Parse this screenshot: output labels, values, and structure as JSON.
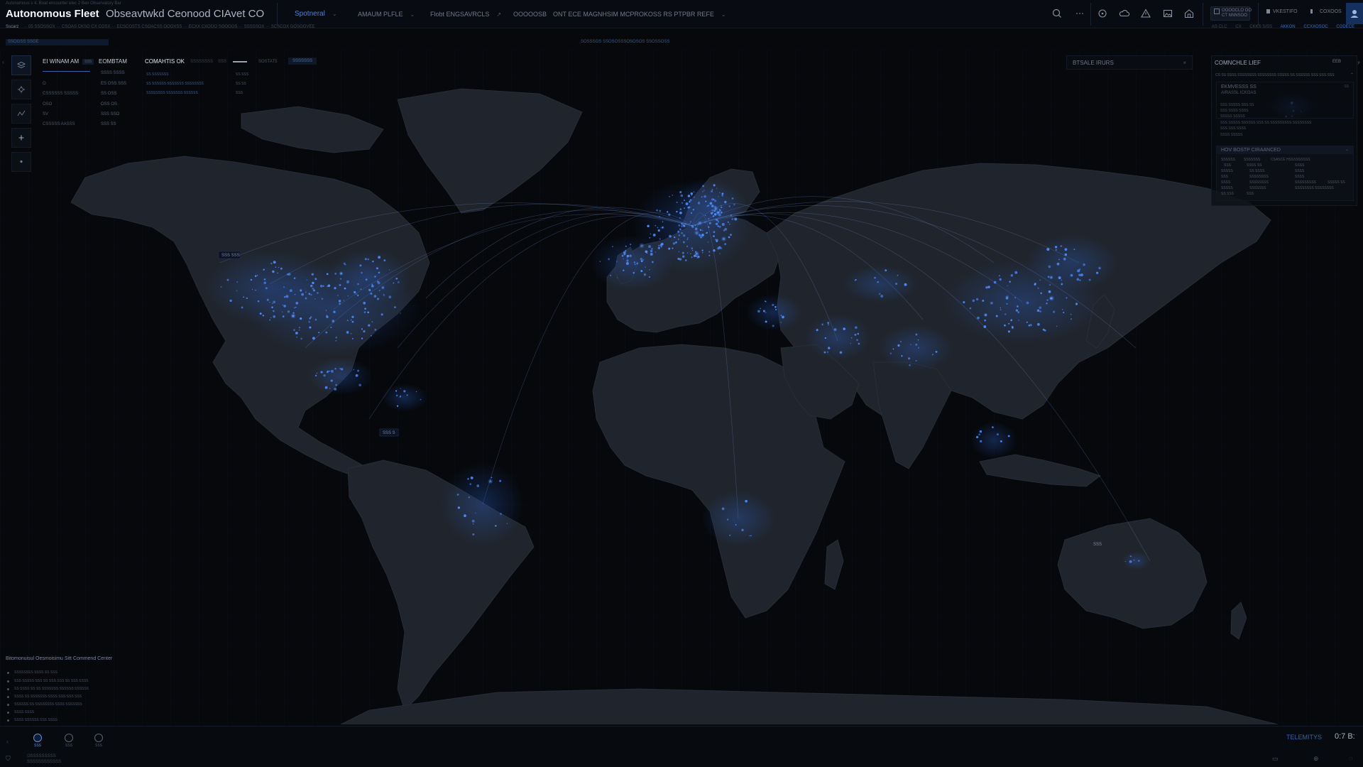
{
  "header": {
    "crumb": "Autonomous v 4. Boat encounter elec 2 Ben Observatory Bar",
    "title": "Autonomous Fleet",
    "subtitle": "Obseavtwkd Ceonood CIAvet CO",
    "nav": [
      {
        "label": "Spotneral",
        "chevron": "⌄"
      },
      {
        "label": "AMAUM PLFLE",
        "chevron": "⌄"
      },
      {
        "label": "Flobt ENGSAVRCLS",
        "chevron": "↗"
      },
      {
        "label": "OOOOOSB",
        "chevron": ""
      },
      {
        "label": "ONT ECE MAGNHSIM MCPROKOSS RS PTPBR REFE",
        "chevron": "⌄"
      }
    ],
    "chip1": "OOOOCLO OO\nCT NNNSOO",
    "label1": "VKESTIFO",
    "label2": "COXOOS"
  },
  "subbar": {
    "left_strong": "Sscarz",
    "left": "·· 05 SSOSSOX ··· CSOAS CKSO CX COSX ··· ECSCOSTS CSOACSS OOOXSS ··· ECXX CXOOO SOOOOS ··· SSSSSOX ··· SCSCOX GOSGGVEE",
    "right": [
      "AS CLC",
      "CX",
      "CKKS SISS",
      "AKKON",
      "CCXXOSOC",
      "CODECE"
    ]
  },
  "filters": {
    "left": "SSOGSS SSGE",
    "center": "SOSSSOS SSOSOSSSOSOSOS SSOSSOSS"
  },
  "stats_panel": {
    "tabs": [
      "EI WINAM AM",
      "EOMBTAM",
      "COMAHTIS OK",
      "SSSSSSSS",
      "SSS",
      "SOSTAT5",
      "SSSSSSS"
    ],
    "tab_badge": "SSS",
    "rows": [
      {
        "k": "",
        "v": "SSSS SSSS"
      },
      {
        "k": "O",
        "v": "ES OSS SSS"
      },
      {
        "k": "CSSSSSS SSSSS",
        "v": "SS OSS"
      },
      {
        "k": "OSO",
        "v": "OSS OS"
      },
      {
        "k": "SV",
        "v": "SSS SSO"
      },
      {
        "k": "CSSSSS AASSS",
        "v": "SSS SS"
      }
    ],
    "mini": [
      {
        "k": "SS SSSSSSS",
        "v": "SS SSS"
      },
      {
        "k": "SS SSSSSS SSSSSSS SSSSSSSS",
        "v": "SS SS"
      },
      {
        "k": "SSSSSSSS SSSSSSS SSSSSS",
        "v": "SSS"
      }
    ]
  },
  "broadcast": {
    "label": "BTSALE IRURS",
    "close": "×"
  },
  "right_panel": {
    "title": "COMNCHLE LIEF",
    "badge": "EEB",
    "arrow": "›",
    "sub": "CS SS SSSS SSSSSSSS SSSSSSSS SSSSS SS SSSSSS SSS SSS SSS",
    "s1_title": "EKMVESSS SS",
    "s1_sub": "AIRASSL ICKOAS",
    "s1_badge": "SS",
    "lines": [
      "SSS SSSSS SSS SS",
      "SSS SSSS SSSS",
      "SSSSS SSSSS",
      "SSS SSSSS SSSSSS SSS SS SSSSSSSSS SSSSSSSS",
      "SSS SSS SSSS",
      "SSSS SSSSS"
    ],
    "s2_title": "HOV BOSTP CIRAANCED",
    "s2_rows": [
      [
        "SSSSSS",
        "SSSSSSS",
        "CSASCE HSSSSSSSSS",
        ""
      ],
      [
        "SSS",
        "SSSS SS",
        "SSSS",
        ""
      ],
      [
        "SSSSS",
        "SS SSSS",
        "SSSS",
        ""
      ],
      [
        "SSS",
        "SSSSSSSS",
        "SSSS",
        ""
      ],
      [
        "SSSS",
        "SSSSSSSS",
        "SSSSSSSSS",
        "SSSSS SS"
      ],
      [
        "SSSSS",
        "SSSSSSS",
        "SSSSSSSS SSSSSSSS",
        ""
      ],
      [
        "SS SSS",
        "SSS",
        "",
        ""
      ]
    ]
  },
  "map_labels": {
    "na": "SSS SSS",
    "sa": "SSS S",
    "au": "SSS"
  },
  "legend": {
    "title": "Bitomonuisul Oesmoisimu Sitt Commend Center",
    "items": [
      "SSSSSSSS SSSS SS SSS",
      "SSS SSSSS SSS SS SSS SSS SS SSS SSSS",
      "SS SSSS SS SS SSSSSSS SSSSSS SSSSSS",
      "SSSS SS SSSSSSS SSSS SSS SSS SSS",
      "SSSSSS SS SSSSSSSS SSSS SSSSSSS",
      "SSSS SSSS",
      "SSSS SSSSSS SSS SSSS"
    ]
  },
  "dock": {
    "buttons": [
      "SSS",
      "SSS",
      "SSS"
    ],
    "status_line1": "OSSSSSSSSS",
    "status_line2": "SSSSSSSSSSSS",
    "telemetry_label": "TELEMITYS",
    "telemetry_value": "0:7 B:"
  },
  "icons": [
    "search-icon",
    "more-icon",
    "target-icon",
    "cloud-icon",
    "alert-icon",
    "image-icon",
    "home-icon",
    "grid-icon",
    "bell-icon",
    "user-icon"
  ],
  "colors": {
    "accent": "#3d78e0",
    "glow": "#5a9cff",
    "land": "#20252d",
    "ocean": "#06080c"
  }
}
